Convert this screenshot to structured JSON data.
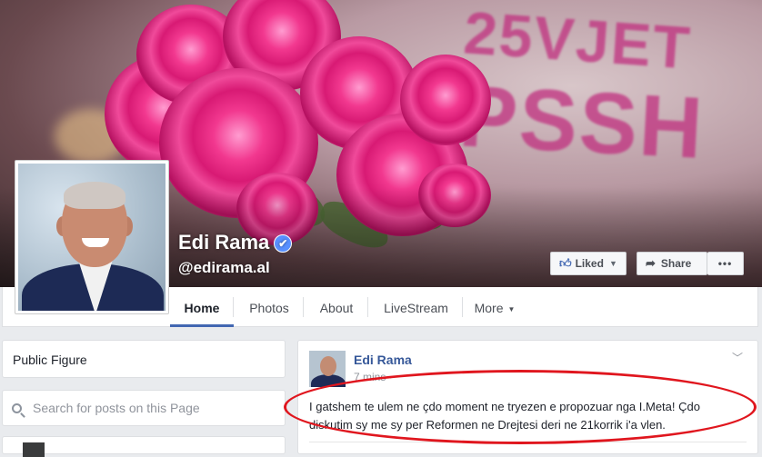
{
  "page": {
    "name": "Edi Rama",
    "handle": "@edirama.al",
    "verified": true,
    "accent_color": "#4267b2"
  },
  "cover": {
    "text_line_1": "25VJET",
    "text_line_2": "PSSH",
    "buttons": {
      "liked": "Liked",
      "share": "Share",
      "more": "•••"
    }
  },
  "tabs": [
    {
      "label": "Home",
      "active": true
    },
    {
      "label": "Photos"
    },
    {
      "label": "About"
    },
    {
      "label": "LiveStream"
    },
    {
      "label": "More"
    }
  ],
  "sidebar": {
    "category": "Public Figure",
    "search_placeholder": "Search for posts on this Page"
  },
  "post": {
    "author": "Edi Rama",
    "time": "7 mins · ",
    "text": "I gatshem te ulem ne çdo moment ne tryezen e propozuar nga I.Meta! Çdo diskutim sy me sy per Reformen ne Drejtesi deri ne 21korrik i'a vlen."
  },
  "annotation_color": "#e0161e",
  "icons": [
    "verified-badge-icon",
    "thumbs-up-icon",
    "caret-down-icon",
    "share-arrow-icon",
    "search-icon",
    "chevron-down-icon"
  ]
}
